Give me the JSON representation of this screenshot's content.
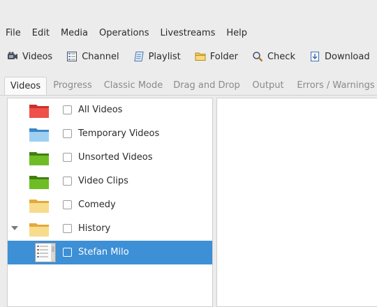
{
  "menu": [
    "File",
    "Edit",
    "Media",
    "Operations",
    "Livestreams",
    "Help"
  ],
  "toolbar": [
    {
      "label": "Videos",
      "icon": "videos-icon"
    },
    {
      "label": "Channel",
      "icon": "channel-icon"
    },
    {
      "label": "Playlist",
      "icon": "playlist-icon"
    },
    {
      "label": "Folder",
      "icon": "folder-icon"
    },
    {
      "label": "Check",
      "icon": "check-icon"
    },
    {
      "label": "Download",
      "icon": "download-icon"
    }
  ],
  "tabs": [
    "Videos",
    "Progress",
    "Classic Mode",
    "Drag and Drop",
    "Output",
    "Errors / Warnings"
  ],
  "active_tab": "Videos",
  "tree": [
    {
      "label": "All Videos",
      "folder_color": "#e8473d"
    },
    {
      "label": "Temporary Videos",
      "folder_color": "#5aa6dc"
    },
    {
      "label": "Unsorted Videos",
      "folder_color": "#5faa1f"
    },
    {
      "label": "Video Clips",
      "folder_color": "#5faa1f"
    },
    {
      "label": "Comedy",
      "folder_color": "#f3cf6a"
    },
    {
      "label": "History",
      "folder_color": "#f3cf6a",
      "expanded": true
    },
    {
      "label": "Stefan Milo",
      "selected": true
    }
  ],
  "colors": {
    "selection": "#3d8fd6",
    "pane_bg": "#ffffff",
    "window_bg": "#ececec"
  }
}
